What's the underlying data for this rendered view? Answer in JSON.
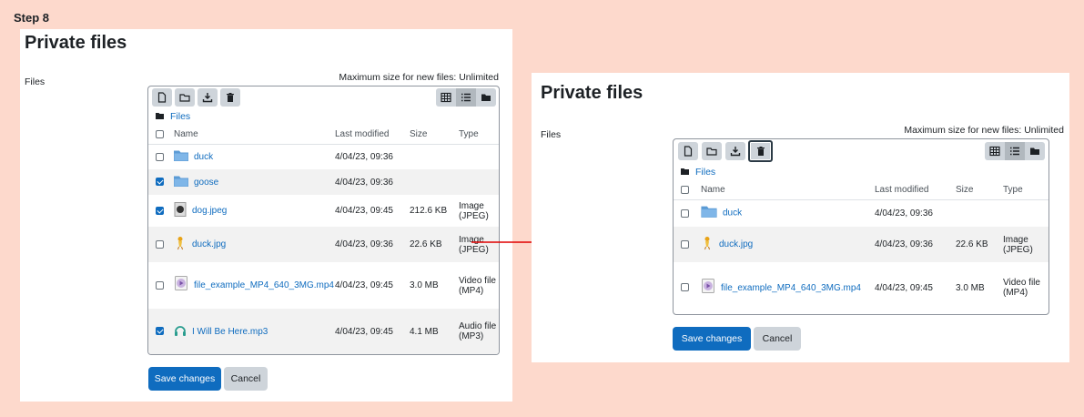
{
  "step_label": "Step 8",
  "left": {
    "title": "Private files",
    "field_label": "Files",
    "max_size": "Maximum size for new files: Unlimited",
    "breadcrumb": "Files",
    "columns": [
      "Name",
      "Last modified",
      "Size",
      "Type"
    ],
    "rows": [
      {
        "name": "duck",
        "modified": "4/04/23, 09:36",
        "size": "",
        "type": "",
        "checked": false,
        "icon": "folder-icon"
      },
      {
        "name": "goose",
        "modified": "4/04/23, 09:36",
        "size": "",
        "type": "",
        "checked": true,
        "icon": "folder-icon"
      },
      {
        "name": "dog.jpeg",
        "modified": "4/04/23, 09:45",
        "size": "212.6 KB",
        "type": "Image (JPEG)",
        "checked": true,
        "icon": "image-icon"
      },
      {
        "name": "duck.jpg",
        "modified": "4/04/23, 09:36",
        "size": "22.6 KB",
        "type": "Image (JPEG)",
        "checked": false,
        "icon": "image-icon"
      },
      {
        "name": "file_example_MP4_640_3MG.mp4",
        "modified": "4/04/23, 09:45",
        "size": "3.0 MB",
        "type": "Video file (MP4)",
        "checked": false,
        "icon": "video-icon"
      },
      {
        "name": "I Will Be Here.mp3",
        "modified": "4/04/23, 09:45",
        "size": "4.1 MB",
        "type": "Audio file (MP3)",
        "checked": true,
        "icon": "audio-icon"
      }
    ],
    "save_label": "Save changes",
    "cancel_label": "Cancel"
  },
  "right": {
    "title": "Private files",
    "field_label": "Files",
    "max_size": "Maximum size for new files: Unlimited",
    "breadcrumb": "Files",
    "columns": [
      "Name",
      "Last modified",
      "Size",
      "Type"
    ],
    "rows": [
      {
        "name": "duck",
        "modified": "4/04/23, 09:36",
        "size": "",
        "type": "",
        "checked": false,
        "icon": "folder-icon"
      },
      {
        "name": "duck.jpg",
        "modified": "4/04/23, 09:36",
        "size": "22.6 KB",
        "type": "Image (JPEG)",
        "checked": false,
        "icon": "image-icon"
      },
      {
        "name": "file_example_MP4_640_3MG.mp4",
        "modified": "4/04/23, 09:45",
        "size": "3.0 MB",
        "type": "Video file (MP4)",
        "checked": false,
        "icon": "video-icon"
      }
    ],
    "save_label": "Save changes",
    "cancel_label": "Cancel"
  },
  "colors": {
    "accent": "#0f6cbf",
    "background": "#fdd9cc",
    "arrow": "#e00000"
  }
}
